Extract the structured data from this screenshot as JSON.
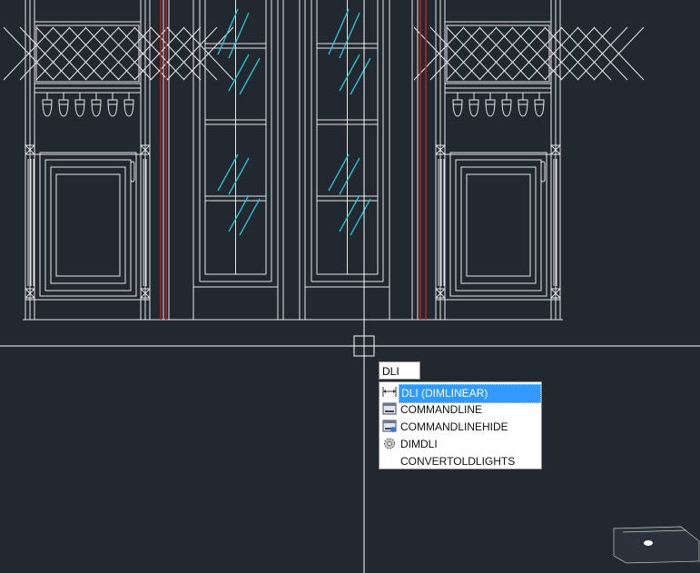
{
  "command_input": {
    "value": "DLI"
  },
  "autocomplete": {
    "items": [
      {
        "label": "DLI (DIMLINEAR)",
        "icon": "dimlinear-icon",
        "selected": true
      },
      {
        "label": "COMMANDLINE",
        "icon": "command-window-icon",
        "selected": false
      },
      {
        "label": "COMMANDLINEHIDE",
        "icon": "command-window-hide-icon",
        "selected": false
      },
      {
        "label": "DIMDLI",
        "icon": "gear-icon",
        "selected": false
      },
      {
        "label": "CONVERTOLDLIGHTS",
        "icon": "",
        "selected": false
      }
    ]
  },
  "colors": {
    "background": "#212830",
    "lines": "#e8e8e8",
    "glass": "#29c8d8",
    "accent_red": "#c02020",
    "highlight": "#3399ff"
  }
}
